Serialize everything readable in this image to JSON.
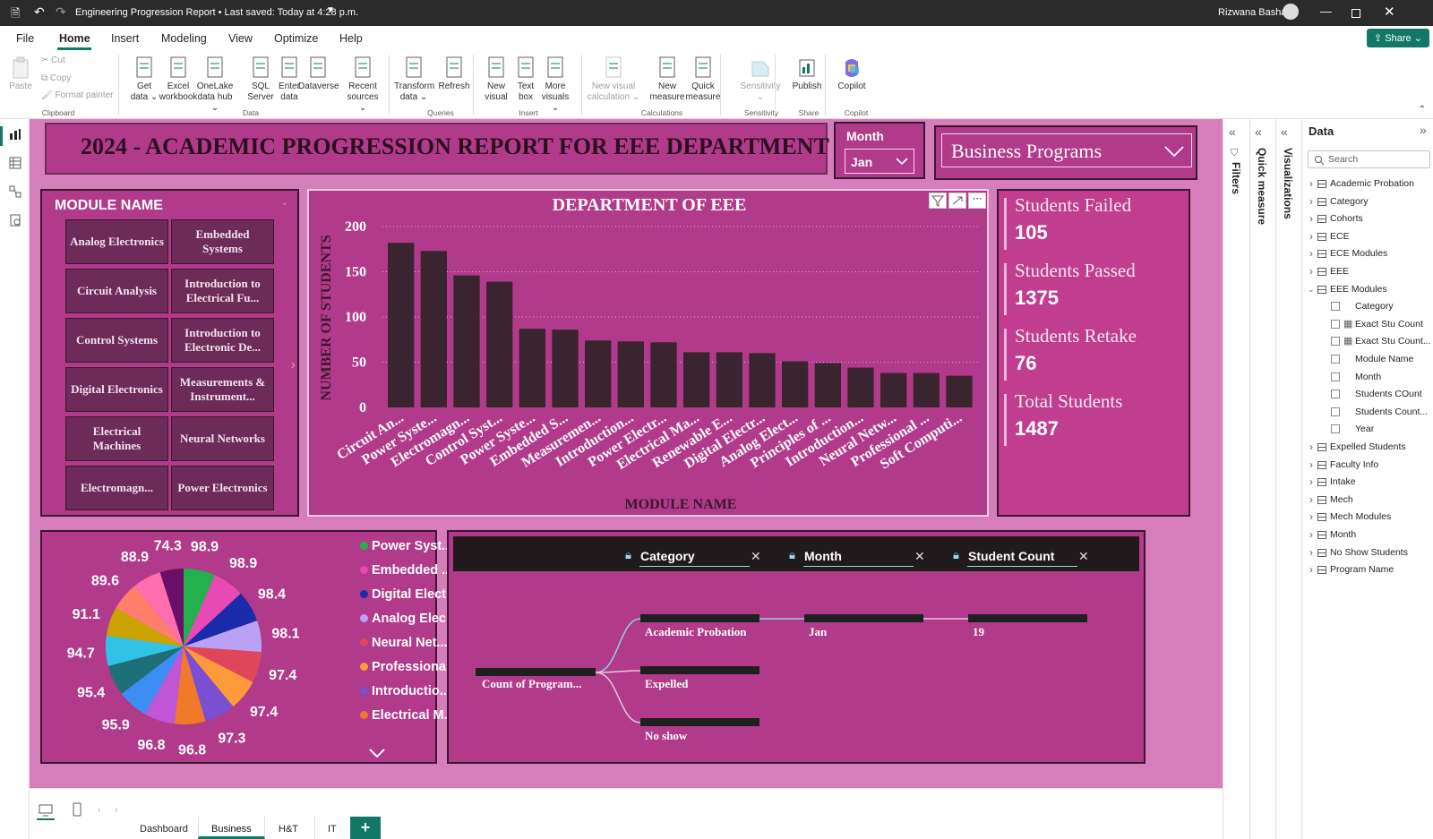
{
  "titlebar": {
    "title": "Engineering Progression Report • Last saved: Today at 4:28 p.m.",
    "user": "Rizwana Basha"
  },
  "menu": [
    "File",
    "Home",
    "Insert",
    "Modeling",
    "View",
    "Optimize",
    "Help"
  ],
  "share": "Share",
  "ribbon": {
    "clipboard": {
      "paste": "Paste",
      "cut": "Cut",
      "copy": "Copy",
      "format_painter": "Format painter",
      "group": "Clipboard"
    },
    "data": {
      "items": [
        [
          "Get",
          "data ⌄"
        ],
        [
          "Excel",
          "workbook"
        ],
        [
          "OneLake",
          "data hub ⌄"
        ],
        [
          "SQL",
          "Server"
        ],
        [
          "Enter",
          "data"
        ],
        [
          "Dataverse",
          ""
        ],
        [
          "Recent",
          "sources ⌄"
        ]
      ],
      "group": "Data"
    },
    "queries": {
      "items": [
        [
          "Transform",
          "data ⌄"
        ],
        [
          "Refresh",
          ""
        ]
      ],
      "group": "Queries"
    },
    "insert": {
      "items": [
        [
          "New",
          "visual"
        ],
        [
          "Text",
          "box"
        ],
        [
          "More",
          "visuals ⌄"
        ]
      ],
      "group": "Insert"
    },
    "calculations": {
      "items": [
        [
          "New visual",
          "calculation ⌄"
        ],
        [
          "New",
          "measure"
        ],
        [
          "Quick",
          "measure"
        ]
      ],
      "group": "Calculations"
    },
    "sensitivity": {
      "label": "Sensitivity",
      "group": "Sensitivity"
    },
    "share": {
      "label": "Publish",
      "group": "Share"
    },
    "copilot": {
      "label": "Copilot",
      "group": "Copilot"
    }
  },
  "report": {
    "title": "2024 - ACADEMIC PROGRESSION REPORT FOR EEE DEPARTMENT",
    "month_slicer": {
      "label": "Month",
      "value": "Jan"
    },
    "program_slicer": {
      "value": "Business Programs"
    },
    "module_slicer": {
      "header": "MODULE NAME",
      "tiles": [
        "Analog Electronics",
        "Embedded Systems",
        "Circuit Analysis",
        "Introduction to Electrical Fu...",
        "Control Systems",
        "Introduction to Electronic De...",
        "Digital Electronics",
        "Measurements & Instrument...",
        "Electrical Machines",
        "Neural Networks",
        "Electromagn...",
        "Power Electronics"
      ]
    },
    "kpis": [
      {
        "label": "Students Failed",
        "value": "105"
      },
      {
        "label": "Students Passed",
        "value": "1375"
      },
      {
        "label": "Students Retake",
        "value": "76"
      },
      {
        "label": "Total Students",
        "value": "1487"
      }
    ],
    "pie_legend": [
      {
        "label": "Power Syst...",
        "color": "#22b14c"
      },
      {
        "label": "Embedded ...",
        "color": "#e84ab3"
      },
      {
        "label": "Digital Elect...",
        "color": "#1a2aa8"
      },
      {
        "label": "Analog Elec...",
        "color": "#b9a2f5"
      },
      {
        "label": "Neural Net...",
        "color": "#e0465a"
      },
      {
        "label": "Professiona...",
        "color": "#ff9a3c"
      },
      {
        "label": "Introductio...",
        "color": "#7a4fd1"
      },
      {
        "label": "Electrical M...",
        "color": "#f07a2a"
      }
    ],
    "decomp": {
      "headers": [
        "Category",
        "Month",
        "Student Count"
      ],
      "root": "Count of Program...",
      "level1": [
        "Academic Probation",
        "Expelled",
        "No show"
      ],
      "level2": "Jan",
      "level3": "19"
    }
  },
  "chart_data": [
    {
      "type": "bar",
      "title": "DEPARTMENT OF EEE",
      "xlabel": "MODULE NAME",
      "ylabel": "NUMBER OF STUDENTS",
      "ylim": [
        0,
        200
      ],
      "yticks": [
        0,
        50,
        100,
        150,
        200
      ],
      "grid": true,
      "categories": [
        "Circuit An...",
        "Power Syste...",
        "Electromagn...",
        "Control Syst...",
        "Power Syste...",
        "Embedded S...",
        "Measuremen...",
        "Introduction...",
        "Power Electr...",
        "Electrical Ma...",
        "Renewable E...",
        "Digital Electr...",
        "Analog Elect...",
        "Principles of ...",
        "Introduction...",
        "Neural Netw...",
        "Professional ...",
        "Soft Computi..."
      ],
      "values": [
        182,
        173,
        146,
        139,
        87,
        86,
        74,
        73,
        72,
        61,
        61,
        60,
        51,
        49,
        44,
        38,
        38,
        35
      ],
      "color": "#3a2430"
    },
    {
      "type": "pie",
      "labels": [
        "74.3",
        "98.9",
        "98.9",
        "98.4",
        "98.1",
        "97.4",
        "97.4",
        "97.3",
        "96.8",
        "96.8",
        "95.9",
        "95.4",
        "94.7",
        "91.1",
        "89.6",
        "88.9"
      ],
      "values": [
        74.3,
        98.9,
        98.9,
        98.4,
        98.1,
        97.4,
        97.4,
        97.3,
        96.8,
        96.8,
        95.9,
        95.4,
        94.7,
        91.1,
        89.6,
        88.9
      ],
      "colors": [
        "#6b0f6b",
        "#22b14c",
        "#e84ab3",
        "#1a2aa8",
        "#b9a2f5",
        "#e0465a",
        "#ff9a3c",
        "#7a4fd1",
        "#f07a2a",
        "#c056d6",
        "#3c8ef5",
        "#1f6f78",
        "#2fc3e6",
        "#caa300",
        "#ff7f6a",
        "#ff6fae"
      ]
    }
  ],
  "page_tabs": [
    "Dashboard",
    "Business",
    "H&T",
    "IT"
  ],
  "panes": {
    "filters": "Filters",
    "quick": "Quick measure",
    "viz": "Visualizations",
    "data_title": "Data",
    "search": "Search"
  },
  "data_tree": [
    {
      "t": "table",
      "label": "Academic Probation"
    },
    {
      "t": "table",
      "label": "Category"
    },
    {
      "t": "table",
      "label": "Cohorts"
    },
    {
      "t": "table",
      "label": "ECE"
    },
    {
      "t": "table",
      "label": "ECE Modules"
    },
    {
      "t": "table",
      "label": "EEE"
    },
    {
      "t": "table-open",
      "label": "EEE Modules"
    },
    {
      "t": "field",
      "label": "Category"
    },
    {
      "t": "measure",
      "label": "Exact Stu Count"
    },
    {
      "t": "measure",
      "label": "Exact Stu Count..."
    },
    {
      "t": "field",
      "label": "Module Name"
    },
    {
      "t": "field",
      "label": "Month"
    },
    {
      "t": "field",
      "label": "Students COunt"
    },
    {
      "t": "field",
      "label": "Students Count..."
    },
    {
      "t": "field",
      "label": "Year"
    },
    {
      "t": "table",
      "label": "Expelled Students"
    },
    {
      "t": "table",
      "label": "Faculty Info"
    },
    {
      "t": "table",
      "label": "Intake"
    },
    {
      "t": "table",
      "label": "Mech"
    },
    {
      "t": "table",
      "label": "Mech Modules"
    },
    {
      "t": "table",
      "label": "Month"
    },
    {
      "t": "table",
      "label": "No Show Students"
    },
    {
      "t": "table",
      "label": "Program Name"
    }
  ]
}
